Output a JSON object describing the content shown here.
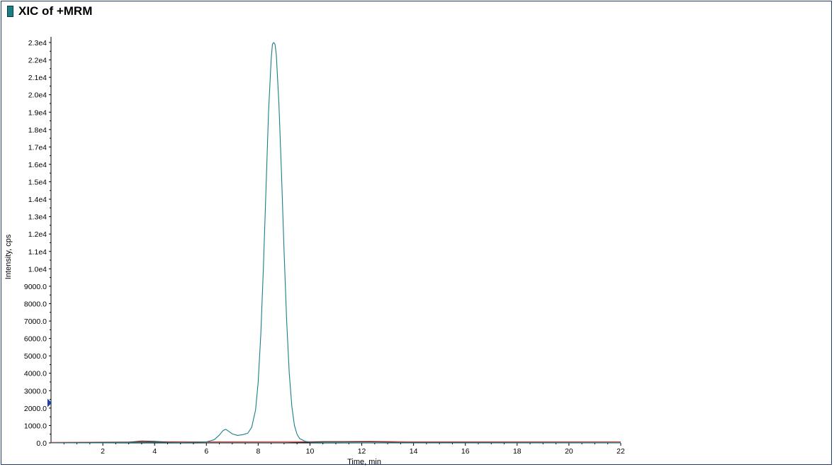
{
  "title": "XIC of +MRM",
  "colors": {
    "frame": "#1f3d66",
    "title_swatch": "#1a7f86",
    "main_trace": "#1a7f86",
    "red_trace": "#e03030",
    "dark_trace": "#333333",
    "marker": "#1f3faa"
  },
  "chart_data": {
    "type": "line",
    "title": "XIC of +MRM",
    "xlabel": "Time, min",
    "ylabel": "Intensity, cps",
    "xlim": [
      0,
      22
    ],
    "ylim": [
      0,
      23000
    ],
    "x_ticks": [
      2,
      4,
      6,
      8,
      10,
      12,
      14,
      16,
      18,
      20,
      22
    ],
    "x_tick_labels": [
      "2",
      "4",
      "6",
      "8",
      "10",
      "12",
      "14",
      "16",
      "18",
      "20",
      "22"
    ],
    "y_ticks": [
      0,
      1000,
      2000,
      3000,
      4000,
      5000,
      6000,
      7000,
      8000,
      9000,
      10000,
      11000,
      12000,
      13000,
      14000,
      15000,
      16000,
      17000,
      18000,
      19000,
      20000,
      21000,
      22000,
      23000
    ],
    "y_tick_labels": [
      "0.0",
      "1000.0",
      "2000.0",
      "3000.0",
      "4000.0",
      "5000.0",
      "6000.0",
      "7000.0",
      "8000.0",
      "9000.0",
      "1.0e4",
      "1.1e4",
      "1.2e4",
      "1.3e4",
      "1.4e4",
      "1.5e4",
      "1.6e4",
      "1.7e4",
      "1.8e4",
      "1.9e4",
      "2.0e4",
      "2.1e4",
      "2.2e4",
      "2.3e4"
    ],
    "grid": false,
    "marker_value": 2300,
    "series": [
      {
        "color": "#1a7f86",
        "x": [
          0.0,
          1.0,
          2.0,
          3.0,
          4.0,
          5.0,
          6.0,
          6.3,
          6.5,
          6.65,
          6.75,
          6.85,
          7.0,
          7.2,
          7.4,
          7.6,
          7.75,
          7.9,
          8.0,
          8.1,
          8.2,
          8.3,
          8.4,
          8.5,
          8.55,
          8.6,
          8.65,
          8.7,
          8.8,
          8.9,
          9.0,
          9.1,
          9.2,
          9.3,
          9.4,
          9.5,
          9.6,
          9.8,
          10.0,
          10.5,
          12.0,
          14.0,
          16.0,
          18.0,
          20.0,
          22.0
        ],
        "values": [
          0,
          0,
          0,
          20,
          40,
          20,
          60,
          180,
          450,
          720,
          780,
          680,
          520,
          430,
          470,
          560,
          900,
          1900,
          3500,
          6200,
          10000,
          14500,
          19000,
          22000,
          22900,
          23000,
          22900,
          22300,
          19500,
          15500,
          11000,
          7000,
          4000,
          2100,
          1000,
          500,
          250,
          100,
          40,
          20,
          10,
          5,
          5,
          5,
          5,
          5
        ]
      },
      {
        "color": "#e03030",
        "x": [
          0.0,
          3.0,
          4.0,
          6.0,
          10.0,
          12.3,
          14.0,
          18.0,
          22.0
        ],
        "values": [
          30,
          50,
          70,
          60,
          70,
          90,
          60,
          60,
          60
        ]
      },
      {
        "color": "#333333",
        "x": [
          0.0,
          3.0,
          3.5,
          4.0,
          4.5,
          6.0,
          9.0,
          10.0,
          10.5,
          12.3,
          14.0,
          22.0
        ],
        "values": [
          0,
          40,
          110,
          90,
          40,
          10,
          10,
          40,
          70,
          60,
          20,
          10
        ]
      }
    ]
  }
}
